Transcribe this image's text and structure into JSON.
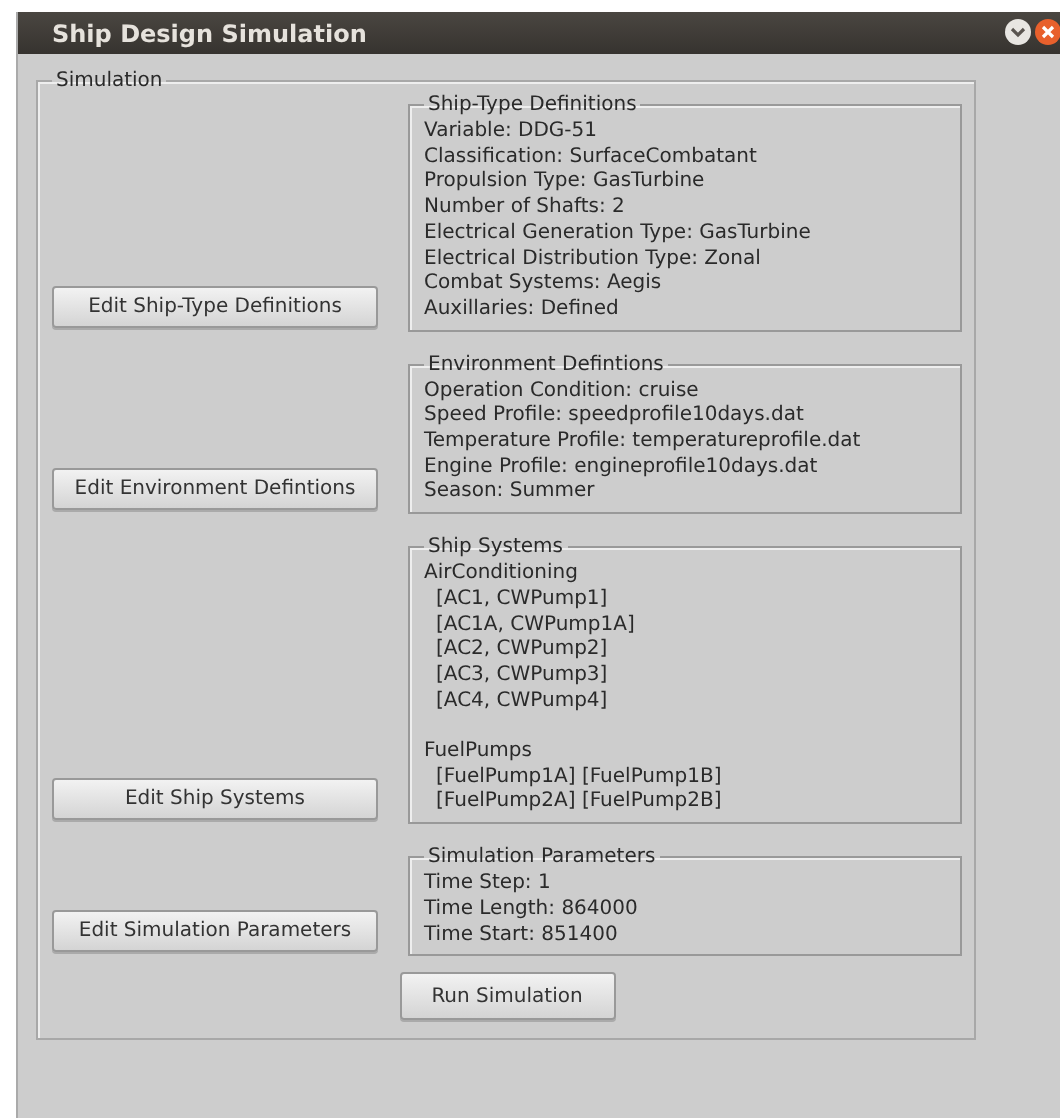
{
  "window": {
    "title": "Ship Design Simulation"
  },
  "simulation": {
    "title": "Simulation",
    "sections": [
      {
        "title": "Ship-Type Definitions",
        "button": "Edit Ship-Type Definitions",
        "lines": [
          "Variable: DDG-51",
          "Classification: SurfaceCombatant",
          "Propulsion Type: GasTurbine",
          "Number of Shafts: 2",
          "Electrical Generation Type: GasTurbine",
          "Electrical Distribution Type: Zonal",
          "Combat Systems: Aegis",
          "Auxillaries: Defined"
        ]
      },
      {
        "title": "Environment Defintions",
        "button": "Edit Environment Defintions",
        "lines": [
          "Operation Condition: cruise",
          "Speed Profile: speedprofile10days.dat",
          "Temperature Profile: temperatureprofile.dat",
          "Engine Profile: engineprofile10days.dat",
          "Season: Summer"
        ]
      },
      {
        "title": "Ship Systems",
        "button": "Edit Ship Systems",
        "groups": [
          {
            "name": "AirConditioning",
            "items": [
              "[AC1, CWPump1]",
              "[AC1A, CWPump1A]",
              "[AC2, CWPump2]",
              "[AC3, CWPump3]",
              "[AC4, CWPump4]"
            ]
          },
          {
            "name": "FuelPumps",
            "items": [
              "[FuelPump1A] [FuelPump1B]",
              "[FuelPump2A] [FuelPump2B]"
            ]
          }
        ]
      },
      {
        "title": "Simulation Parameters",
        "button": "Edit Simulation Parameters",
        "lines": [
          "Time Step: 1",
          "Time Length: 864000",
          "Time Start: 851400"
        ]
      }
    ],
    "run_button": "Run Simulation"
  }
}
